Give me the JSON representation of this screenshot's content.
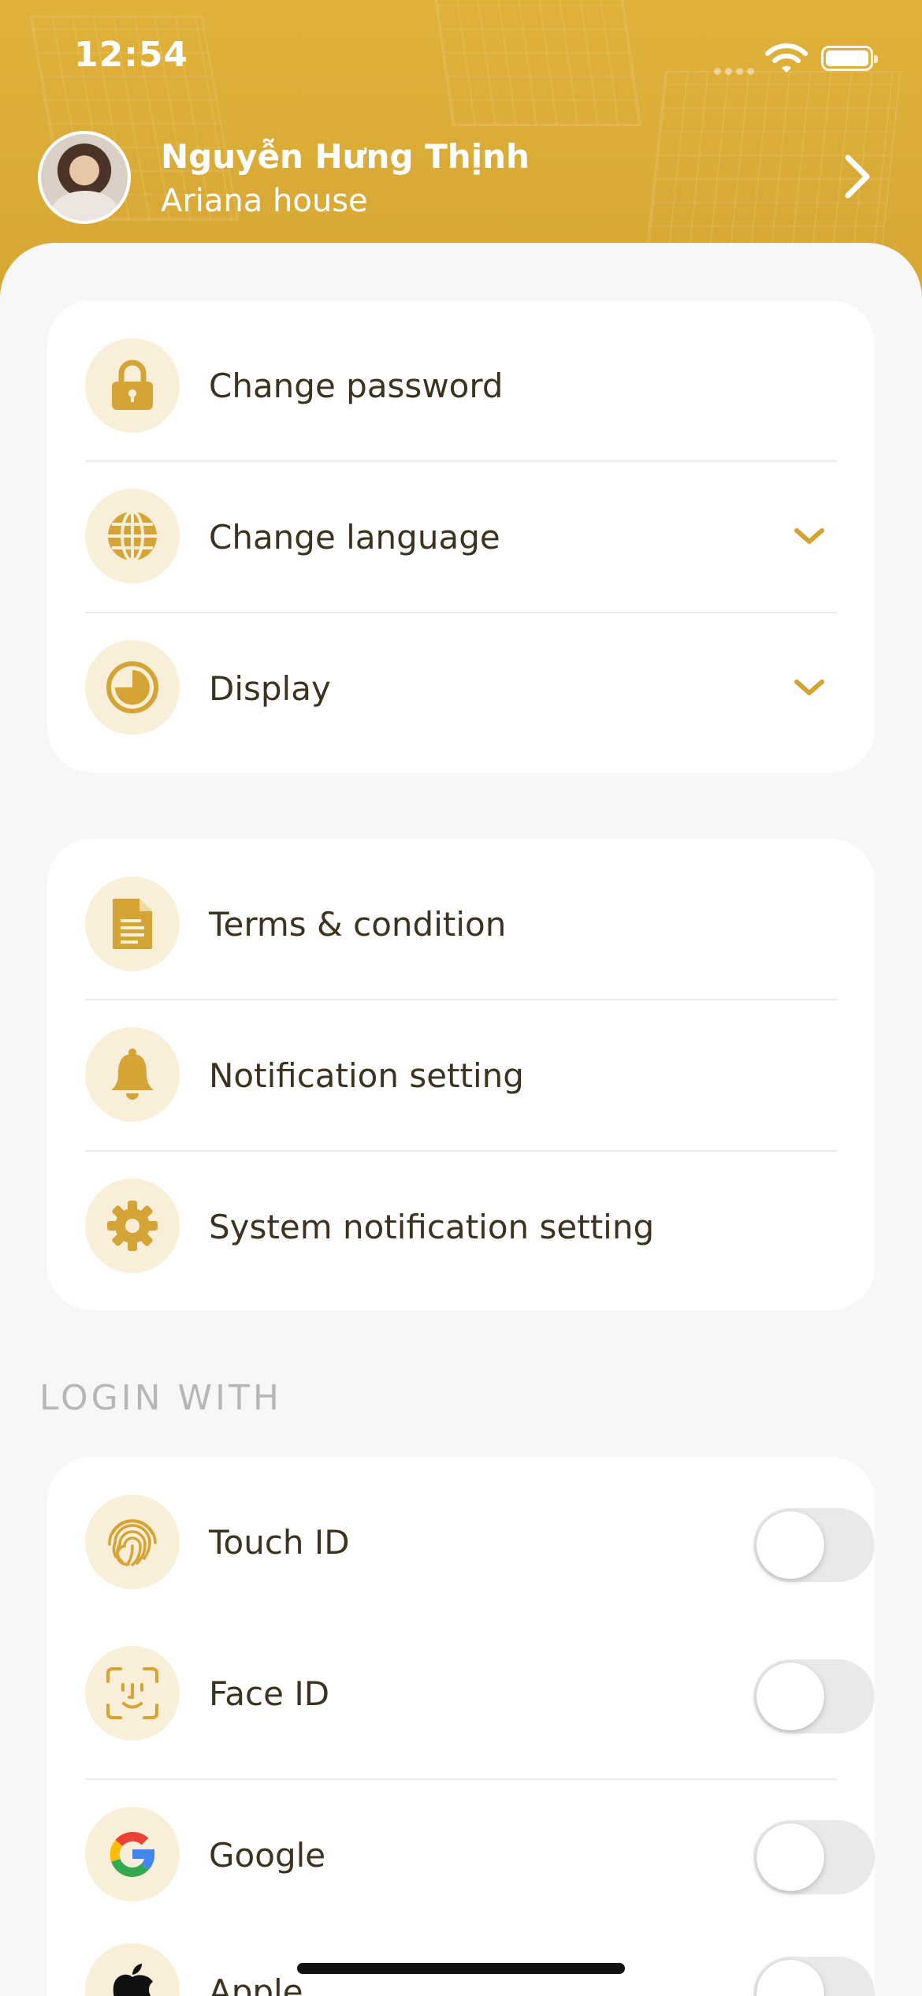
{
  "status_bar": {
    "time": "12:54"
  },
  "profile": {
    "name": "Nguyễn Hưng Thịnh",
    "subtitle": "Ariana house"
  },
  "settings_group_1": [
    {
      "label": "Change password",
      "icon": "lock-icon"
    },
    {
      "label": "Change language",
      "icon": "globe-icon",
      "expandable": true
    },
    {
      "label": "Display",
      "icon": "display-icon",
      "expandable": true
    }
  ],
  "settings_group_2": [
    {
      "label": "Terms & condition",
      "icon": "document-icon"
    },
    {
      "label": "Notification setting",
      "icon": "bell-icon"
    },
    {
      "label": "System notification setting",
      "icon": "gear-icon"
    }
  ],
  "login_section": {
    "title": "LOGIN WITH",
    "items": [
      {
        "label": "Touch ID",
        "icon": "fingerprint-icon",
        "enabled": false
      },
      {
        "label": "Face ID",
        "icon": "face-id-icon",
        "enabled": false
      },
      {
        "label": "Google",
        "icon": "google-icon",
        "enabled": false
      },
      {
        "label": "Apple",
        "icon": "apple-icon",
        "enabled": false
      }
    ]
  },
  "colors": {
    "header": "#dbab37",
    "accent": "#d4a437",
    "icon_bg": "#f9efd8",
    "text": "#3b331f",
    "section_title": "#b7b7b7"
  }
}
